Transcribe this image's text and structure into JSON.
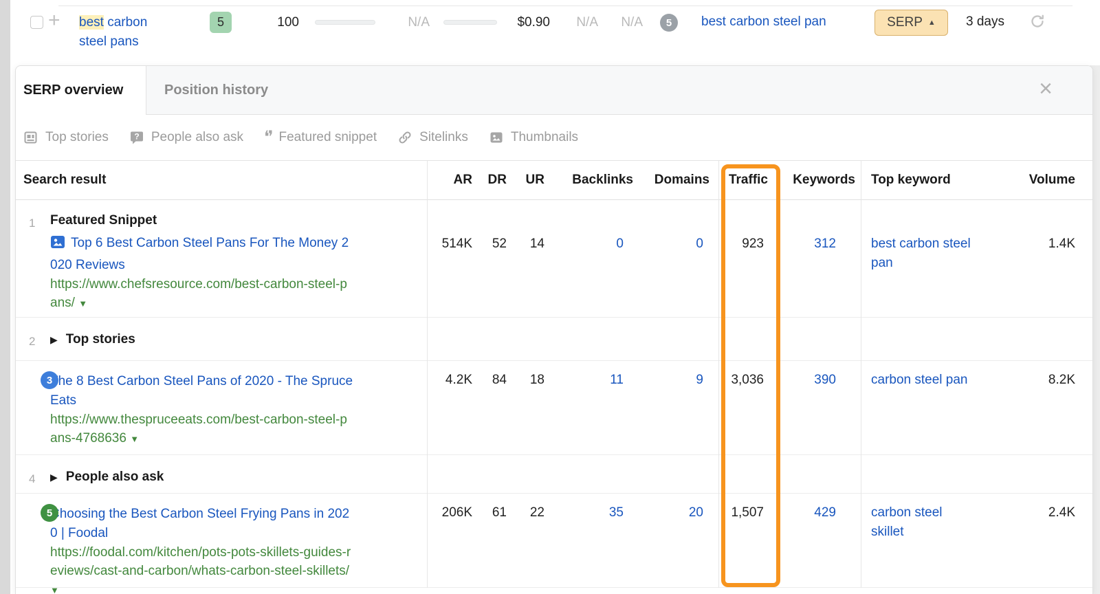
{
  "keyword_row": {
    "keyword": {
      "highlighted": "best",
      "rest": " carbon steel pans"
    },
    "kd": "5",
    "volume": "100",
    "clicks": "N/A",
    "cpc": "$0.90",
    "cps": "N/A",
    "rr": "N/A",
    "serp_features_count": "5",
    "top_keyword": "best carbon steel pan",
    "serp_button_label": "SERP",
    "updated": "3 days"
  },
  "panel": {
    "tabs": [
      {
        "label": "SERP overview"
      },
      {
        "label": "Position history"
      }
    ],
    "serp_features": [
      {
        "icon": "top-stories-icon",
        "label": "Top stories"
      },
      {
        "icon": "people-also-ask-icon",
        "label": "People also ask"
      },
      {
        "icon": "featured-snippet-icon",
        "label": "Featured snippet"
      },
      {
        "icon": "sitelinks-icon",
        "label": "Sitelinks"
      },
      {
        "icon": "thumbnails-icon",
        "label": "Thumbnails"
      }
    ],
    "table": {
      "headers": {
        "search_result": "Search result",
        "ar": "AR",
        "dr": "DR",
        "ur": "UR",
        "backlinks": "Backlinks",
        "domains": "Domains",
        "traffic": "Traffic",
        "keywords": "Keywords",
        "top_keyword": "Top keyword",
        "volume": "Volume"
      },
      "rows": [
        {
          "num": "1",
          "group": "Featured Snippet",
          "title": "Top 6 Best Carbon Steel Pans For The Money 2020 Reviews",
          "url": "https://www.chefsresource.com/best-carbon-steel-pans/",
          "ar": "514K",
          "dr": "52",
          "ur": "14",
          "backlinks": "0",
          "domains": "0",
          "traffic": "923",
          "keywords": "312",
          "top_keyword": "best carbon steel pan",
          "volume": "1.4K"
        },
        {
          "num": "2",
          "group": "Top stories"
        },
        {
          "num": "3",
          "title": "The 8 Best Carbon Steel Pans of 2020 - The Spruce Eats",
          "url": "https://www.thespruceeats.com/best-carbon-steel-pans-4768636",
          "ar": "4.2K",
          "dr": "84",
          "ur": "18",
          "backlinks": "11",
          "domains": "9",
          "traffic": "3,036",
          "keywords": "390",
          "top_keyword": "carbon steel pan",
          "volume": "8.2K"
        },
        {
          "num": "4",
          "group": "People also ask"
        },
        {
          "num": "5",
          "title": "Choosing the Best Carbon Steel Frying Pans in 2020 | Foodal",
          "url": "https://foodal.com/kitchen/pots-pots-skillets-guides-reviews/cast-and-carbon/whats-carbon-steel-skillets/",
          "ar": "206K",
          "dr": "61",
          "ur": "22",
          "backlinks": "35",
          "domains": "20",
          "traffic": "1,507",
          "keywords": "429",
          "top_keyword": "carbon steel skillet",
          "volume": "2.4K"
        }
      ]
    }
  },
  "colors": {
    "accent_orange": "#f7941e",
    "link_blue": "#1956be",
    "url_green": "#43883d",
    "kd_badge_green": "#a3d4b0",
    "serp_button_tan": "#fbe2b3",
    "highlight_yellow": "#fdf0ba",
    "badge_blue": "#3d7edb",
    "badge_green": "#3f9142"
  }
}
